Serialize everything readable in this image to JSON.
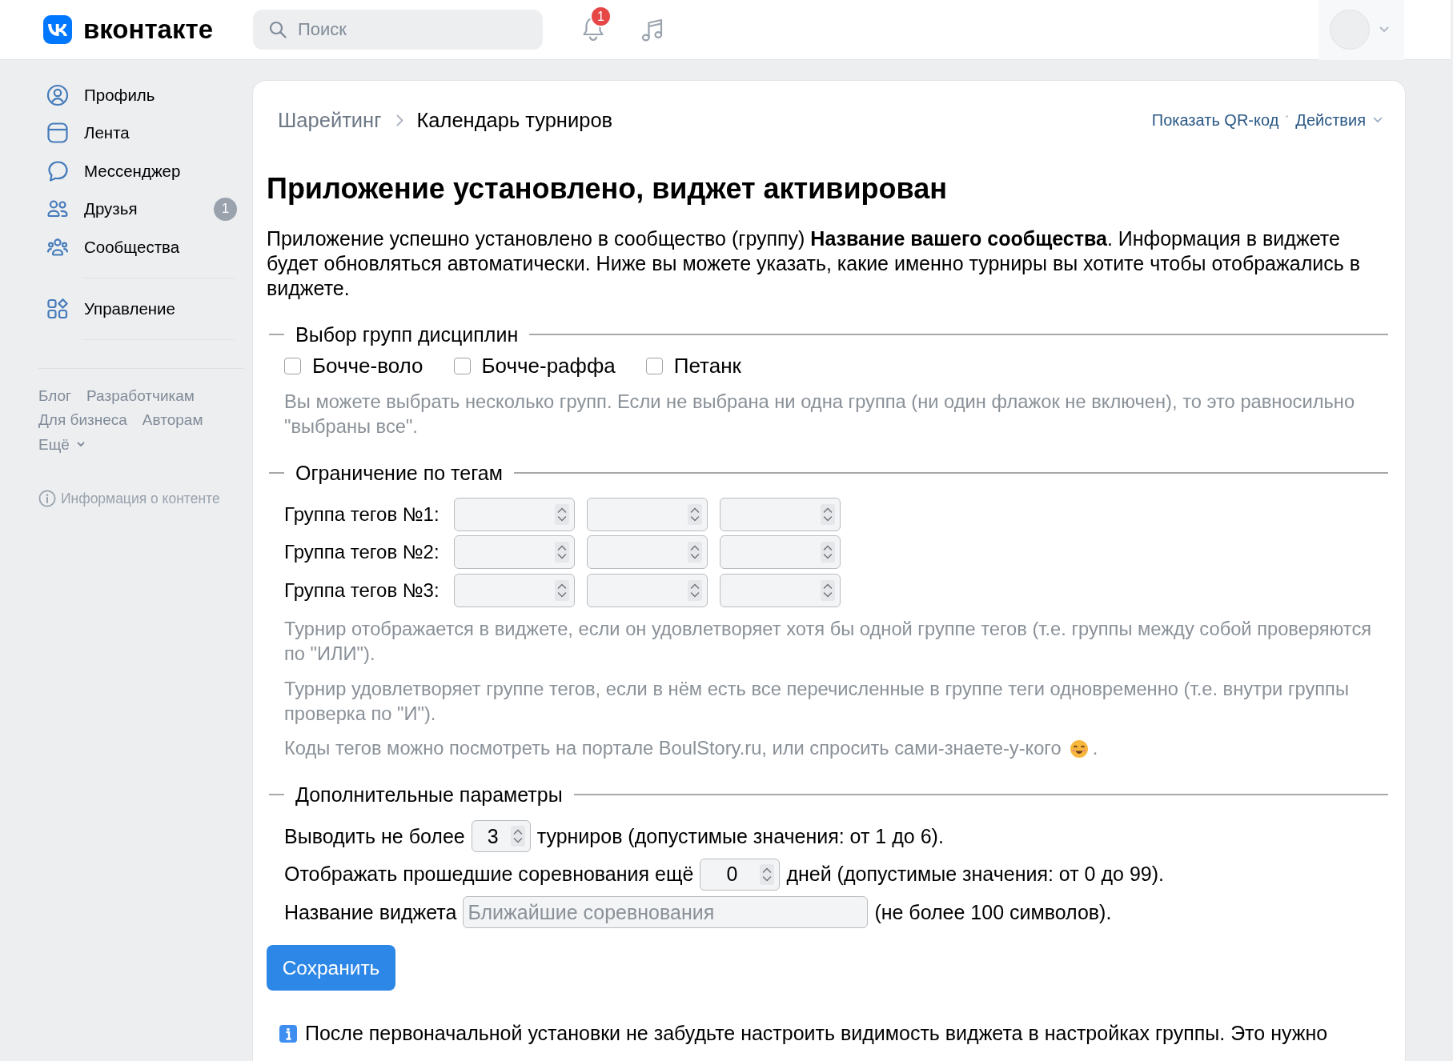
{
  "header": {
    "logo_text": "вконтакте",
    "search": {
      "placeholder": "Поиск"
    },
    "notifications_badge": "1"
  },
  "sidebar": {
    "sections": [
      {
        "items": [
          {
            "label": "Профиль",
            "selected": false
          },
          {
            "label": "Лента",
            "selected": false
          },
          {
            "label": "Мессенджер",
            "selected": false
          },
          {
            "label": "Друзья",
            "selected": false,
            "badge": "1"
          },
          {
            "label": "Сообщества",
            "selected": false
          }
        ]
      },
      {
        "items": [
          {
            "label": "Управление",
            "selected": false
          }
        ]
      }
    ],
    "footer_links": [
      [
        "Блог",
        "Разработчикам"
      ],
      [
        "Для бизнеса",
        "Авторам"
      ]
    ],
    "more_link": "Ещё",
    "content_info": "Информация о контенте"
  },
  "main": {
    "breadcrumb": [
      "Шарейтинг",
      "Календарь турниров"
    ],
    "actions": [
      {
        "label": "Показать QR-код",
        "kind": "link"
      },
      {
        "label": "Действия",
        "kind": "menu"
      }
    ],
    "title": "Приложение установлено, виджет активирован",
    "intro": "Приложение успешно установлено в сообщество (группу) **Название вашего сообщества**. Информация в виджете будет обновляться автоматически. Ниже вы можете указать, какие именно турниры вы хотите чтобы отображались в виджете.",
    "sections": [
      {
        "kind": "checkboxes",
        "legend": "Выбор групп дисциплин",
        "checkboxes": [
          {
            "label": "Бочче-воло",
            "checked": false
          },
          {
            "label": "Бочче-раффа",
            "checked": false
          },
          {
            "label": "Петанк",
            "checked": false
          }
        ],
        "hints": [
          {
            "kind": "plain",
            "text": "Вы можете выбрать несколько групп. Если не выбрана ни одна группа (ни один флажок не включен), то это равносильно \"выбраны все\"."
          }
        ]
      },
      {
        "kind": "tags",
        "legend": "Ограничение по тегам",
        "tag_groups": [
          {
            "label": "Группа тегов №1:",
            "fields": [
              {
                "kind": "number"
              },
              {
                "kind": "number"
              },
              {
                "kind": "number"
              }
            ]
          },
          {
            "label": "Группа тегов №2:",
            "fields": [
              {
                "kind": "number"
              },
              {
                "kind": "number"
              },
              {
                "kind": "number"
              }
            ]
          },
          {
            "label": "Группа тегов №3:",
            "fields": [
              {
                "kind": "number"
              },
              {
                "kind": "number"
              },
              {
                "kind": "number"
              }
            ]
          }
        ],
        "hints": [
          {
            "kind": "plain",
            "text": "Турнир отображается в виджете, если он удовлетворяет хотя бы одной группе тегов (т.е. группы между собой проверяются по \"ИЛИ\")."
          },
          {
            "kind": "plain",
            "text": "Турнир удовлетворяет группе тегов, если в нём есть все перечисленные в группе теги одновременно (т.е. внутри группы проверка по \"И\")."
          },
          {
            "kind": "with_emoji",
            "text": "Коды тегов можно посмотреть на портале BoulStory.ru, или спросить сами-знаете-у-кого",
            "tail": "."
          }
        ]
      },
      {
        "kind": "params",
        "legend": "Дополнительные параметры",
        "rows": [
          {
            "kind": "number",
            "label": "Выводить не более",
            "value": "3",
            "note": "турниров (допустимые значения: от 1 до 6)."
          },
          {
            "kind": "number",
            "label": "Отображать прошедшие соревнования ещё",
            "value": "0",
            "note": "дней (допустимые значения: от 0 до 99)."
          },
          {
            "kind": "text",
            "label": "Название виджета",
            "placeholder": "Ближайшие соревнования",
            "note": "(не более 100 символов)."
          }
        ]
      }
    ],
    "save_button": "Сохранить",
    "notice": "После первоначальной установки не забудьте настроить видимость виджета в настройках группы. Это нужно"
  }
}
